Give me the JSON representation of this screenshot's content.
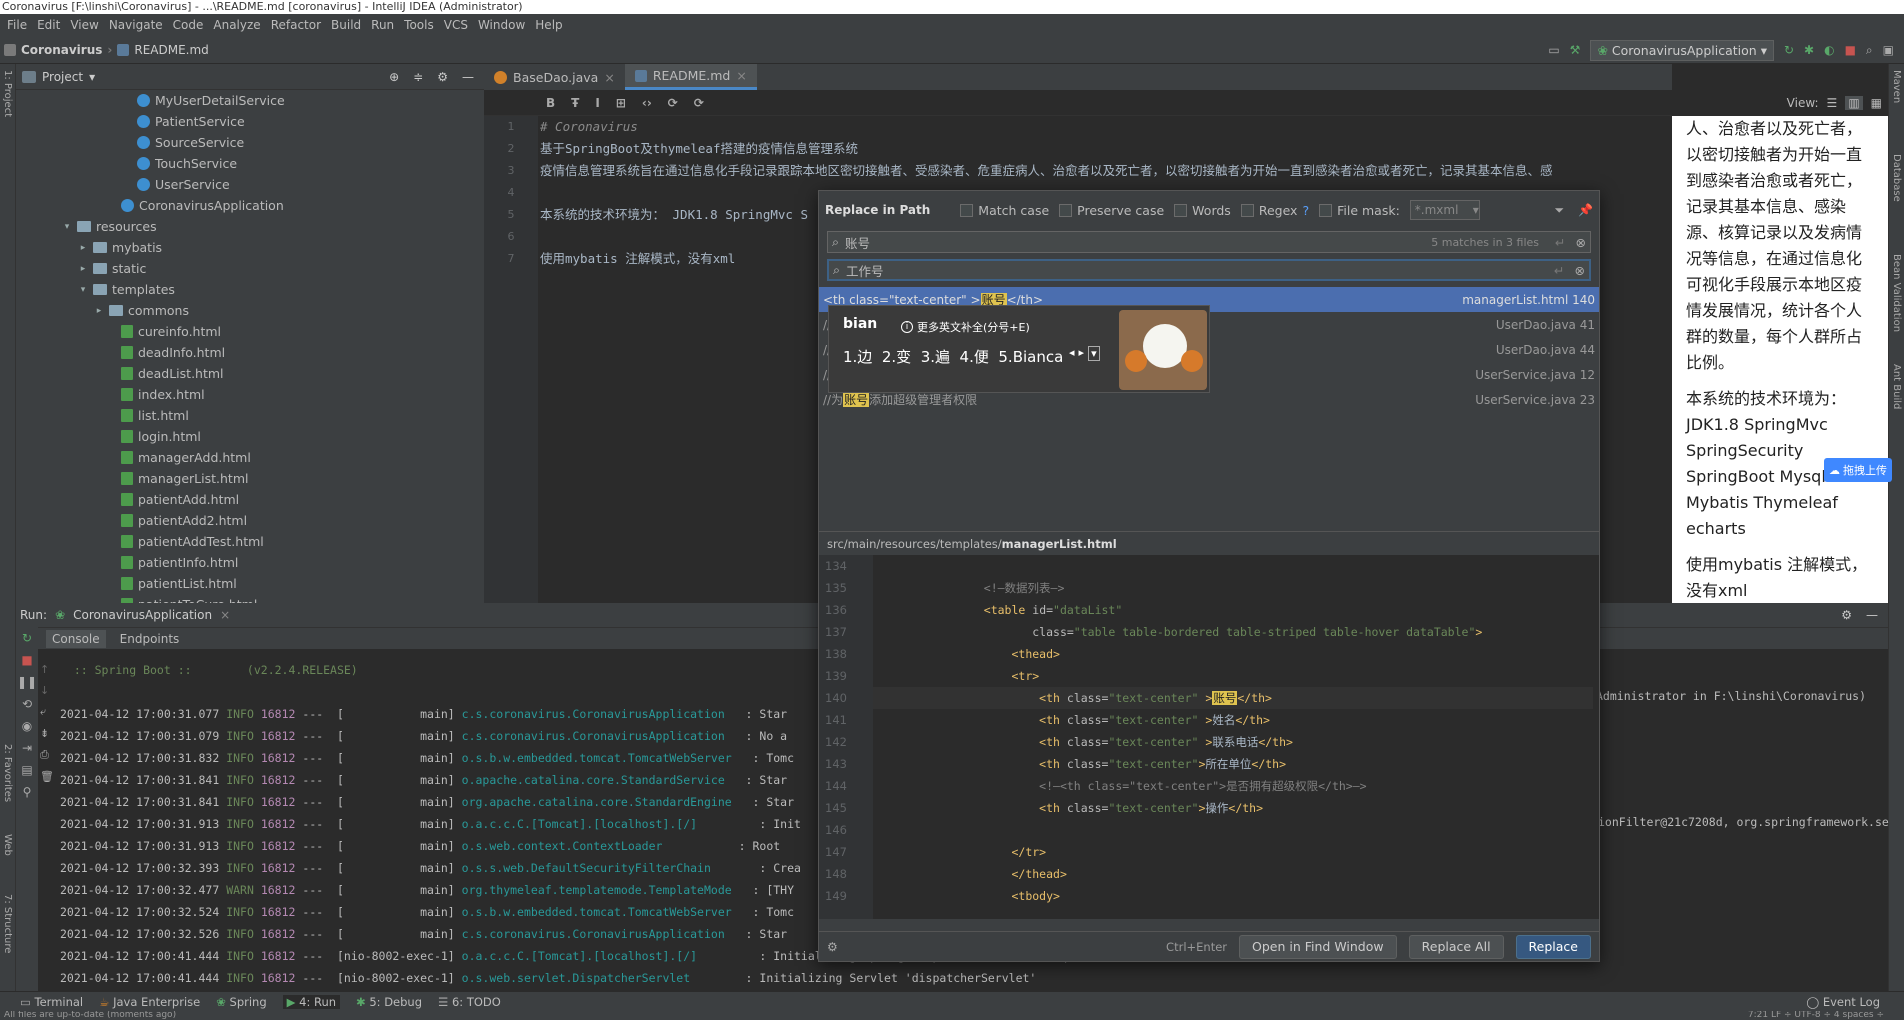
{
  "window": {
    "title": "Coronavirus [F:\\linshi\\Coronavirus] - ...\\README.md [coronavirus] - IntelliJ IDEA (Administrator)"
  },
  "menu": [
    "File",
    "Edit",
    "View",
    "Navigate",
    "Code",
    "Analyze",
    "Refactor",
    "Build",
    "Run",
    "Tools",
    "VCS",
    "Window",
    "Help"
  ],
  "breadcrumb": {
    "project": "Coronavirus",
    "file": "README.md"
  },
  "run_config": "CoronavirusApplication",
  "project_panel": {
    "title": "Project",
    "items": [
      {
        "label": "MyUserDetailService",
        "type": "class"
      },
      {
        "label": "PatientService",
        "type": "class"
      },
      {
        "label": "SourceService",
        "type": "class"
      },
      {
        "label": "TouchService",
        "type": "class"
      },
      {
        "label": "UserService",
        "type": "class"
      },
      {
        "label": "CoronavirusApplication",
        "type": "class"
      },
      {
        "label": "resources",
        "type": "folder"
      },
      {
        "label": "mybatis",
        "type": "folder"
      },
      {
        "label": "static",
        "type": "folder"
      },
      {
        "label": "templates",
        "type": "folder"
      },
      {
        "label": "commons",
        "type": "folder"
      },
      {
        "label": "cureinfo.html",
        "type": "html"
      },
      {
        "label": "deadInfo.html",
        "type": "html"
      },
      {
        "label": "deadList.html",
        "type": "html"
      },
      {
        "label": "index.html",
        "type": "html"
      },
      {
        "label": "list.html",
        "type": "html"
      },
      {
        "label": "login.html",
        "type": "html"
      },
      {
        "label": "managerAdd.html",
        "type": "html"
      },
      {
        "label": "managerList.html",
        "type": "html"
      },
      {
        "label": "patientAdd.html",
        "type": "html"
      },
      {
        "label": "patientAdd2.html",
        "type": "html"
      },
      {
        "label": "patientAddTest.html",
        "type": "html"
      },
      {
        "label": "patientInfo.html",
        "type": "html"
      },
      {
        "label": "patientList.html",
        "type": "html"
      },
      {
        "label": "patientToCure.html",
        "type": "html"
      }
    ]
  },
  "editor_tabs": [
    "BaseDao.java",
    "README.md"
  ],
  "md_toolbar": [
    "B",
    "Ŧ",
    "I",
    "⊞",
    "‹›",
    "⟳",
    "⟳"
  ],
  "editor": {
    "lines": [
      {
        "no": "1",
        "text": "# Coronavirus"
      },
      {
        "no": "2",
        "text": "基于SpringBoot及thymeleaf搭建的疫情信息管理系统"
      },
      {
        "no": "3",
        "text": "疫情信息管理系统旨在通过信息化手段记录跟踪本地区密切接触者、受感染者、危重症病人、治愈者以及死亡者，以密切接触者为开始一直到感染者治愈或者死亡，记录其基本信息、感"
      },
      {
        "no": "4",
        "text": ""
      },
      {
        "no": "5",
        "text": "本系统的技术环境为： JDK1.8 SpringMvc S"
      },
      {
        "no": "6",
        "text": ""
      },
      {
        "no": "7",
        "text": "使用mybatis 注解模式，没有xml"
      }
    ]
  },
  "preview": {
    "view_label": "View:",
    "paragraphs": [
      "人、治愈者以及死亡者，以密切接触者为开始一直到感染者治愈或者死亡，记录其基本信息、感染源、核算记录以及发病情况等信息，在通过信息化可视化手段展示本地区疫情发展情况，统计各个人群的数量，每个人群所占比例。",
      "本系统的技术环境为：JDK1.8 SpringMvc SpringSecurity SpringBoot Mysql Mybatis Thymeleaf echarts",
      "使用mybatis 注解模式，没有xml"
    ],
    "upload_label": "拖拽上传"
  },
  "replace_dialog": {
    "title": "Replace in Path",
    "options": [
      "Match case",
      "Preserve case",
      "Words",
      "Regex",
      "File mask:"
    ],
    "regex_help": "?",
    "file_mask": "*.mxml",
    "search_text": "账号",
    "match_info": "5 matches in 3 files",
    "replace_text": "工作号",
    "results": [
      {
        "text": "<th class=\"text-center\" >账号</th>",
        "file": "managerList.html 140"
      },
      {
        "text": "//根据账号查找用户",
        "file": "UserDao.java 41"
      },
      {
        "text": "//为账号添加超级管理者权限",
        "file": "UserDao.java 44"
      },
      {
        "text": "//根据账号查找用户",
        "file": "UserService.java 12"
      },
      {
        "text": "//为账号添加超级管理者权限",
        "file": "UserService.java 23"
      }
    ],
    "path": "src/main/resources/templates/",
    "path_file": "managerList.html",
    "code_lines": [
      {
        "no": "134",
        "html": ""
      },
      {
        "no": "135",
        "html": "<span class='cmt'>&lt;!—数据列表—&gt;</span>",
        "indent": "                "
      },
      {
        "no": "136",
        "html": "<span class='tag'>&lt;table</span> <span class='attr'>id=</span><span class='str'>\"dataList\"</span>",
        "indent": "                "
      },
      {
        "no": "137",
        "html": "       <span class='attr'>class=</span><span class='str'>\"table table-bordered table-striped table-hover dataTable\"</span><span class='tag'>&gt;</span>",
        "indent": "                "
      },
      {
        "no": "138",
        "html": "<span class='tag'>&lt;thead&gt;</span>",
        "indent": "                    "
      },
      {
        "no": "139",
        "html": "<span class='tag'>&lt;tr&gt;</span>",
        "indent": "                    "
      },
      {
        "no": "140",
        "html": "<span class='tag'>&lt;th</span> <span class='attr'>class=</span><span class='str'>\"text-center\"</span> <span class='tag'>&gt;</span><span class='hl'>账号</span><span class='tag'>&lt;/th&gt;</span>",
        "indent": "                        "
      },
      {
        "no": "141",
        "html": "<span class='tag'>&lt;th</span> <span class='attr'>class=</span><span class='str'>\"text-center\"</span> <span class='tag'>&gt;</span>姓名<span class='tag'>&lt;/th&gt;</span>",
        "indent": "                        "
      },
      {
        "no": "142",
        "html": "<span class='tag'>&lt;th</span> <span class='attr'>class=</span><span class='str'>\"text-center\"</span> <span class='tag'>&gt;</span>联系电话<span class='tag'>&lt;/th&gt;</span>",
        "indent": "                        "
      },
      {
        "no": "143",
        "html": "<span class='tag'>&lt;th</span> <span class='attr'>class=</span><span class='str'>\"text-center\"</span><span class='tag'>&gt;</span>所在单位<span class='tag'>&lt;/th&gt;</span>",
        "indent": "                        "
      },
      {
        "no": "144",
        "html": "<span class='cmt'>&lt;!—&lt;th class=\"text-center\"&gt;是否拥有超级权限&lt;/th&gt;—&gt;</span>",
        "indent": "                        "
      },
      {
        "no": "145",
        "html": "<span class='tag'>&lt;th</span> <span class='attr'>class=</span><span class='str'>\"text-center\"</span><span class='tag'>&gt;</span>操作<span class='tag'>&lt;/th&gt;</span>",
        "indent": "                        "
      },
      {
        "no": "146",
        "html": ""
      },
      {
        "no": "147",
        "html": "<span class='tag'>&lt;/tr&gt;</span>",
        "indent": "                    "
      },
      {
        "no": "148",
        "html": "<span class='tag'>&lt;/thead&gt;</span>",
        "indent": "                    "
      },
      {
        "no": "149",
        "html": "<span class='tag'>&lt;tbody&gt;</span>",
        "indent": "                    "
      }
    ],
    "shortcut": "Ctrl+Enter",
    "btn_find_window": "Open in Find Window",
    "btn_replace_all": "Replace All",
    "btn_replace": "Replace"
  },
  "ime": {
    "typed": "bian",
    "hint": "更多英文补全(分号+E)",
    "candidates": "1.边  2.变  3.遍  4.便  5.Bianca"
  },
  "run_panel": {
    "label": "Run:",
    "config": "CoronavirusApplication",
    "tabs": [
      "Console",
      "Endpoints"
    ],
    "banner": "  :: Spring Boot ::        (v2.2.4.RELEASE)",
    "logs": [
      {
        "ts": "2021-04-12 17:00:31.077",
        "lvl": "INFO",
        "pid": "16812",
        "th": "---  [           main]",
        "cls": "c.s.coronavirus.CoronavirusApplication",
        "msg": "  : Star"
      },
      {
        "ts": "2021-04-12 17:00:31.079",
        "lvl": "INFO",
        "pid": "16812",
        "th": "---  [           main]",
        "cls": "c.s.coronavirus.CoronavirusApplication",
        "msg": "  : No a"
      },
      {
        "ts": "2021-04-12 17:00:31.832",
        "lvl": "INFO",
        "pid": "16812",
        "th": "---  [           main]",
        "cls": "o.s.b.w.embedded.tomcat.TomcatWebServer",
        "msg": "  : Tomc"
      },
      {
        "ts": "2021-04-12 17:00:31.841",
        "lvl": "INFO",
        "pid": "16812",
        "th": "---  [           main]",
        "cls": "o.apache.catalina.core.StandardService",
        "msg": "  : Star"
      },
      {
        "ts": "2021-04-12 17:00:31.841",
        "lvl": "INFO",
        "pid": "16812",
        "th": "---  [           main]",
        "cls": "org.apache.catalina.core.StandardEngine",
        "msg": "  : Star"
      },
      {
        "ts": "2021-04-12 17:00:31.913",
        "lvl": "INFO",
        "pid": "16812",
        "th": "---  [           main]",
        "cls": "o.a.c.c.C.[Tomcat].[localhost].[/]",
        "msg": "        : Init"
      },
      {
        "ts": "2021-04-12 17:00:31.913",
        "lvl": "INFO",
        "pid": "16812",
        "th": "---  [           main]",
        "cls": "o.s.web.context.ContextLoader",
        "msg": "          : Root"
      },
      {
        "ts": "2021-04-12 17:00:32.393",
        "lvl": "INFO",
        "pid": "16812",
        "th": "---  [           main]",
        "cls": "o.s.s.web.DefaultSecurityFilterChain",
        "msg": "      : Crea"
      },
      {
        "ts": "2021-04-12 17:00:32.477",
        "lvl": "WARN",
        "pid": "16812",
        "th": "---  [           main]",
        "cls": "org.thymeleaf.templatemode.TemplateMode",
        "msg": "  : [THY"
      },
      {
        "ts": "2021-04-12 17:00:32.524",
        "lvl": "INFO",
        "pid": "16812",
        "th": "---  [           main]",
        "cls": "o.s.b.w.embedded.tomcat.TomcatWebServer",
        "msg": "  : Tomc"
      },
      {
        "ts": "2021-04-12 17:00:32.526",
        "lvl": "INFO",
        "pid": "16812",
        "th": "---  [           main]",
        "cls": "c.s.coronavirus.CoronavirusApplication",
        "msg": "  : Star"
      },
      {
        "ts": "2021-04-12 17:00:41.444",
        "lvl": "INFO",
        "pid": "16812",
        "th": "---  [nio-8002-exec-1]",
        "cls": "o.a.c.c.C.[Tomcat].[localhost].[/]",
        "msg": "        : Initializing Spring DispatcherServlet 'dispatcherServlet'"
      },
      {
        "ts": "2021-04-12 17:00:41.444",
        "lvl": "INFO",
        "pid": "16812",
        "th": "---  [nio-8002-exec-1]",
        "cls": "o.s.web.servlet.DispatcherServlet",
        "msg": "       : Initializing Servlet 'dispatcherServlet'"
      }
    ],
    "right_text_1": "Administrator in F:\\linshi\\Coronavirus)",
    "right_text_2": "ionFilter@21c7208d, org.springframework.se"
  },
  "bottom_tabs": [
    "Terminal",
    "Java Enterprise",
    "Spring",
    "4: Run",
    "5: Debug",
    "6: TODO"
  ],
  "event_log": "Event Log",
  "status": {
    "left": "All files are up-to-date (moments ago)",
    "right": "7:21  LF ÷  UTF-8 ÷  4 spaces ÷"
  },
  "left_stripe": [
    "1: Project",
    "2: Favorites",
    "Web",
    "7: Structure"
  ],
  "right_stripe": [
    "Maven",
    "Database",
    "Bean Validation",
    "Ant Build"
  ],
  "colors": {
    "accent": "#4b6eaf",
    "highlight": "#dfc34f",
    "run_green": "#499c54"
  }
}
